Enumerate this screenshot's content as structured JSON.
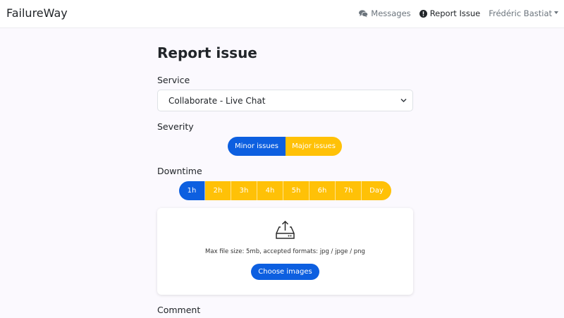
{
  "navbar": {
    "brand": "FailureWay",
    "messages_label": "Messages",
    "report_label": "Report Issue",
    "user_label": "Frédéric Bastiat"
  },
  "page": {
    "title": "Report issue",
    "service_label": "Service",
    "service_value": "Collaborate - Live Chat",
    "severity_label": "Severity",
    "severity_options": [
      "Minor issues",
      "Major issues"
    ],
    "severity_selected": "Minor issues",
    "downtime_label": "Downtime",
    "downtime_options": [
      "1h",
      "2h",
      "3h",
      "4h",
      "5h",
      "6h",
      "7h",
      "Day"
    ],
    "downtime_selected": "1h",
    "upload_hint": "Max file size: 5mb, accepted formats: jpg / jpge / png",
    "choose_button": "Choose images",
    "comment_label": "Comment"
  },
  "colors": {
    "primary": "#0d5fe0",
    "warning": "#ffc107",
    "background": "#fbf9fe"
  }
}
